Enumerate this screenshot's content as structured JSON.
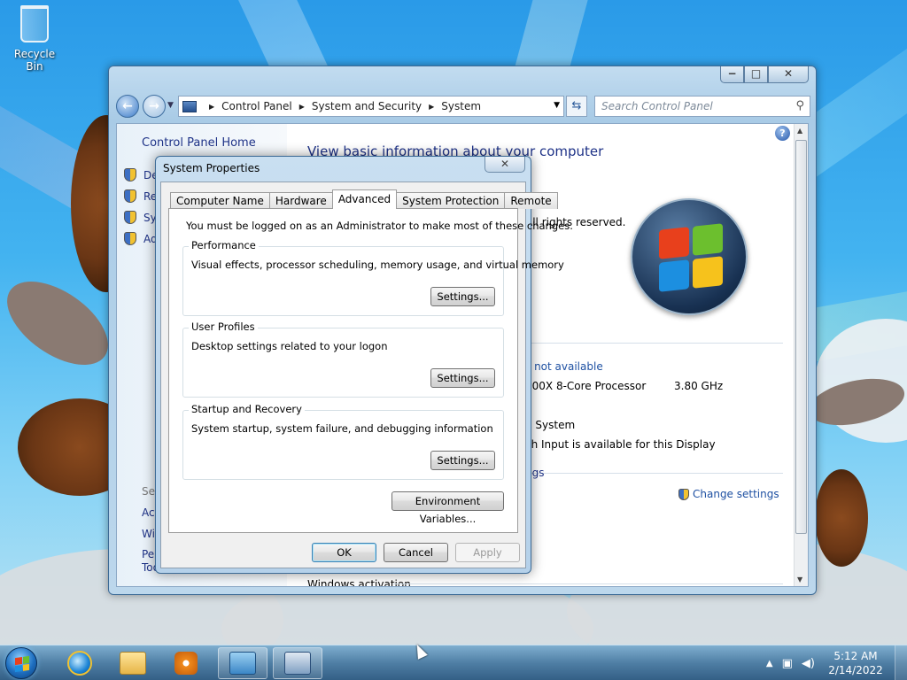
{
  "desktop": {
    "recycle_bin_label": "Recycle Bin"
  },
  "control_panel": {
    "buttons": {
      "minimize": "−",
      "maximize": "□",
      "close": "✕"
    },
    "nav": {
      "back": "←",
      "forward": "→"
    },
    "breadcrumb": [
      "Control Panel",
      "System and Security",
      "System"
    ],
    "search_placeholder": "Search Control Panel",
    "left": {
      "home": "Control Panel Home",
      "items": [
        "Dev",
        "Ren",
        "Sys",
        "Adv"
      ],
      "see_also": "See",
      "links": [
        "Acti",
        "Win",
        "Perf",
        "Too"
      ]
    },
    "main": {
      "heading": "View basic information about your computer",
      "copyright_fragment": "All rights reserved.",
      "rating_fragment": "s not available",
      "processor_fragment": "800X 8-Core Processor",
      "processor_speed": "3.80 GHz",
      "system_type_fragment": "g System",
      "pen_touch_fragment": "ch Input is available for this Display",
      "settings_section_fragment": "ngs",
      "change_settings": "Change settings",
      "activation_heading": "Windows activation"
    }
  },
  "system_properties": {
    "title": "System Properties",
    "close": "✕",
    "tabs": [
      "Computer Name",
      "Hardware",
      "Advanced",
      "System Protection",
      "Remote"
    ],
    "active_tab": "Advanced",
    "admin_note": "You must be logged on as an Administrator to make most of these changes.",
    "groups": [
      {
        "title": "Performance",
        "description": "Visual effects, processor scheduling, memory usage, and virtual memory",
        "button": "Settings..."
      },
      {
        "title": "User Profiles",
        "description": "Desktop settings related to your logon",
        "button": "Settings..."
      },
      {
        "title": "Startup and Recovery",
        "description": "System startup, system failure, and debugging information",
        "button": "Settings..."
      }
    ],
    "env_button": "Environment Variables...",
    "ok": "OK",
    "cancel": "Cancel",
    "apply": "Apply"
  },
  "taskbar": {
    "pinned": [
      "start-button",
      "internet-explorer",
      "windows-explorer",
      "media-player",
      "control-panel",
      "system-properties"
    ],
    "clock_time": "5:12 AM",
    "clock_date": "2/14/2022"
  },
  "colors": {
    "link_blue": "#1e3287",
    "dialog_frame": "#b5d1ea",
    "taskbar": "#2d5a82",
    "win_red": "#e8401c",
    "win_green": "#6cbf2e",
    "win_blue": "#1c8fe0",
    "win_yellow": "#f6c21c"
  }
}
